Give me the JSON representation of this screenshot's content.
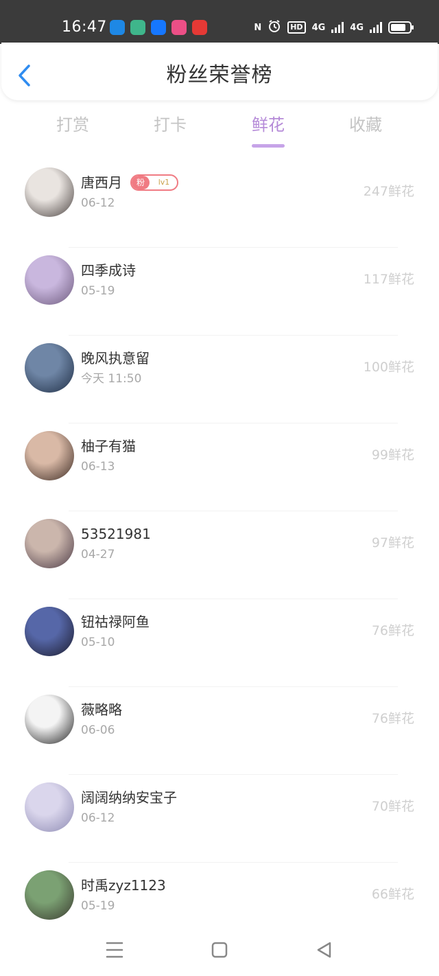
{
  "status_bar": {
    "time": "16:47",
    "app_icons": [
      {
        "name": "app-icon-blue-circle",
        "color": "#1e88e5"
      },
      {
        "name": "app-icon-green-chat",
        "color": "#3fb68b"
      },
      {
        "name": "app-icon-alipay",
        "color": "#1677ff"
      },
      {
        "name": "app-icon-pink",
        "color": "#ec4f86"
      },
      {
        "name": "app-icon-red-play",
        "color": "#e53935"
      }
    ],
    "nfc_label": "N",
    "hd_label": "HD",
    "network_1": "4G",
    "network_2": "4G",
    "battery_level": 0.8
  },
  "header": {
    "back_icon": "chevron-left-icon",
    "title": "粉丝荣誉榜",
    "accent_color": "#2f8cf0"
  },
  "tabs": [
    {
      "label": "打赏",
      "active": false
    },
    {
      "label": "打卡",
      "active": false
    },
    {
      "label": "鲜花",
      "active": true
    },
    {
      "label": "收藏",
      "active": false
    }
  ],
  "fans": [
    {
      "name": "唐西月",
      "date": "06-12",
      "count": "247鲜花",
      "badge": {
        "left": "粉",
        "right": "lv1"
      },
      "avatar_colors": [
        "#e9e4e0",
        "#4a4240"
      ]
    },
    {
      "name": "四季成诗",
      "date": "05-19",
      "count": "117鲜花",
      "avatar_colors": [
        "#c9b7de",
        "#6d5a7d"
      ]
    },
    {
      "name": "晚风执意留",
      "date": "今天 11:50",
      "count": "100鲜花",
      "avatar_colors": [
        "#6f86a6",
        "#1f2e45"
      ]
    },
    {
      "name": "柚子有猫",
      "date": "06-13",
      "count": "99鲜花",
      "avatar_colors": [
        "#d9b9a6",
        "#3b2a23"
      ]
    },
    {
      "name": "53521981",
      "date": "04-27",
      "count": "97鲜花",
      "avatar_colors": [
        "#cbb6ac",
        "#4b3a46"
      ]
    },
    {
      "name": "钮祜禄阿鱼",
      "date": "05-10",
      "count": "76鲜花",
      "avatar_colors": [
        "#5667a8",
        "#1b1b2c"
      ]
    },
    {
      "name": "薇略略",
      "date": "06-06",
      "count": "76鲜花",
      "avatar_colors": [
        "#f4f4f4",
        "#222222"
      ]
    },
    {
      "name": "阔阔纳纳安宝子",
      "date": "06-12",
      "count": "70鲜花",
      "avatar_colors": [
        "#dad6ec",
        "#8d8ab3"
      ]
    },
    {
      "name": "时禹zyz1123",
      "date": "05-19",
      "count": "66鲜花",
      "avatar_colors": [
        "#7ba173",
        "#3a3a2f"
      ]
    }
  ],
  "nav": {
    "menu_icon": "menu-icon",
    "home_icon": "square-home-icon",
    "back_icon": "triangle-back-icon"
  }
}
